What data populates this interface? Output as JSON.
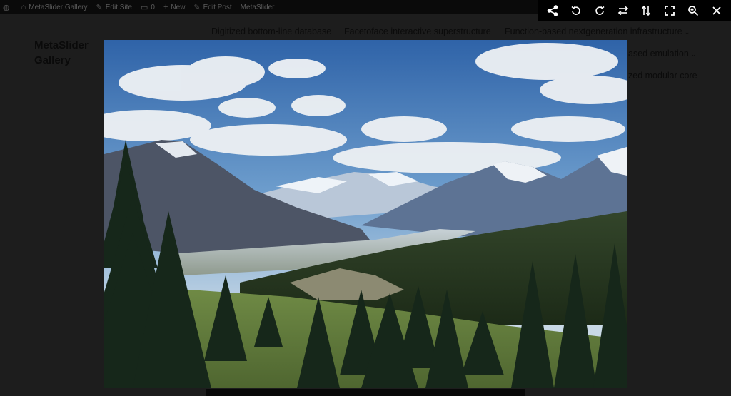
{
  "admin_bar": {
    "site_name": "MetaSlider Gallery",
    "edit_site": "Edit Site",
    "comments_count": "0",
    "new_label": "New",
    "edit_post": "Edit Post",
    "plugin": "MetaSlider"
  },
  "site": {
    "title": "MetaSlider Gallery",
    "menu": [
      {
        "label": "Digitized bottom-line database",
        "dropdown": false
      },
      {
        "label": "Facetoface interactive superstructure",
        "dropdown": false
      },
      {
        "label": "Function-based nextgeneration infrastructure",
        "dropdown": true
      },
      {
        "label": "ased emulation",
        "dropdown": true
      },
      {
        "label": "zed modular core",
        "dropdown": false
      }
    ]
  },
  "toolbar": {
    "icons": [
      "share-icon",
      "rotate-left-icon",
      "rotate-right-icon",
      "flip-horizontal-icon",
      "flip-vertical-icon",
      "fullscreen-icon",
      "zoom-in-icon",
      "close-icon"
    ],
    "icon_color": "#ffffff"
  },
  "image": {
    "subject": "mountain landscape with evergreen forest"
  },
  "colors": {
    "overlay": "#1d1d1d",
    "toolbar_bg": "#000000"
  }
}
